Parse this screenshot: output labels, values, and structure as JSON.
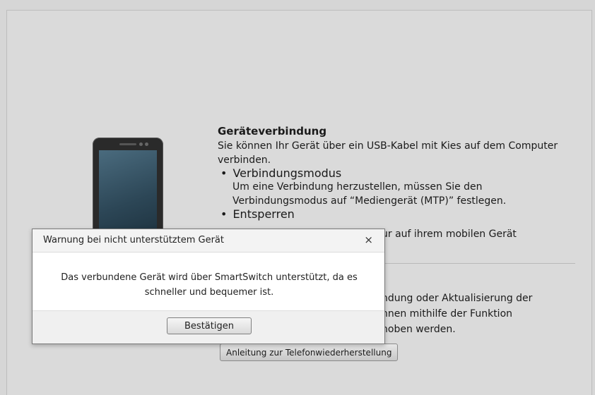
{
  "device_section": {
    "heading": "Geräteverbindung",
    "intro": "Sie können Ihr Gerät über ein USB-Kabel mit Kies auf dem Computer verbinden.",
    "bullets": [
      {
        "title": "Verbindungsmodus",
        "text": "Um eine Verbindung herzustellen, müssen Sie den Verbindungsmodus auf “Mediengerät (MTP)” festlegen."
      },
      {
        "title": "Entsperren",
        "text_visible": "ur auf ihrem mobilen Gerät"
      }
    ]
  },
  "restore_section": {
    "text_lines": [
      "ndung oder Aktualisierung der",
      "nnen mithilfe der Funktion",
      "hoben werden."
    ],
    "button_label": "Anleitung zur Telefonwiederherstellung"
  },
  "dialog": {
    "title": "Warnung bei nicht unterstütztem Gerät",
    "close_glyph": "×",
    "message": "Das verbundene Gerät wird über SmartSwitch unterstützt, da es schneller und bequemer ist.",
    "confirm_label": "Bestätigen"
  },
  "colors": {
    "background": "#dadada",
    "dialog_bg": "#ffffff",
    "dialog_footer": "#f0f0f0"
  },
  "icons": {
    "phone": "smartphone-icon",
    "close": "close-icon"
  }
}
